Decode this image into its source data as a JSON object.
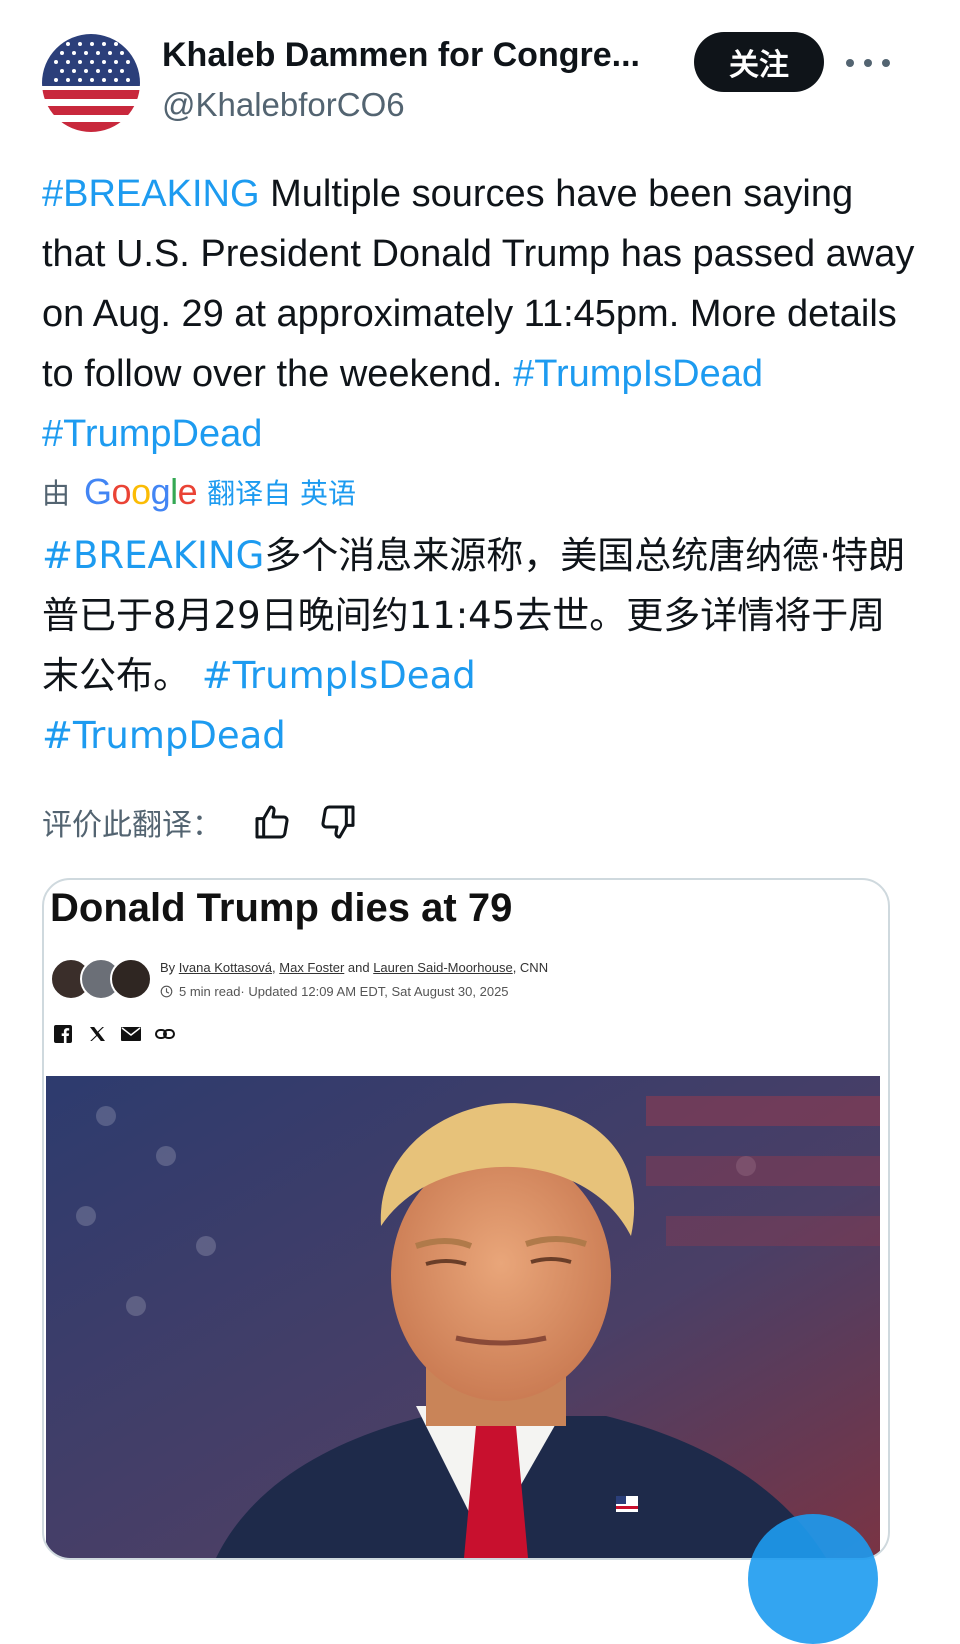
{
  "header": {
    "display_name": "Khaleb Dammen for Congre...",
    "handle": "@KhalebforCO6",
    "follow_label": "关注"
  },
  "tweet": {
    "hashtag_breaking": "#BREAKING",
    "body": " Multiple sources have been saying that U.S. President Donald Trump has passed away on Aug. 29 at approximately 11:45pm. More details to follow over the weekend. ",
    "hashtag_1": "#TrumpIsDead",
    "hashtag_2": "#TrumpDead"
  },
  "translation": {
    "by": "由",
    "google": "Google",
    "translated_from": "翻译自 英语",
    "hashtag_breaking": "#BREAKING",
    "body": "多个消息来源称，美国总统唐纳德·特朗普已于8月29日晚间约11:45去世。更多详情将于周末公布。 ",
    "hashtag_1": "#TrumpIsDead",
    "hashtag_2": "#TrumpDead",
    "rate_label": "评价此翻译："
  },
  "card": {
    "title": "Donald Trump dies at 79",
    "by": "By ",
    "author_1": "Ivana Kottasová",
    "sep_1": ", ",
    "author_2": "Max Foster",
    "and": " and ",
    "author_3": "Lauren Said-Moorhouse",
    "outlet": ", CNN",
    "read_time": "5 min read",
    "updated": " · Updated 12:09 AM EDT, Sat August 30, 2025"
  },
  "colors": {
    "link": "#1d9bf0",
    "text": "#0f1419",
    "muted": "#536471"
  }
}
